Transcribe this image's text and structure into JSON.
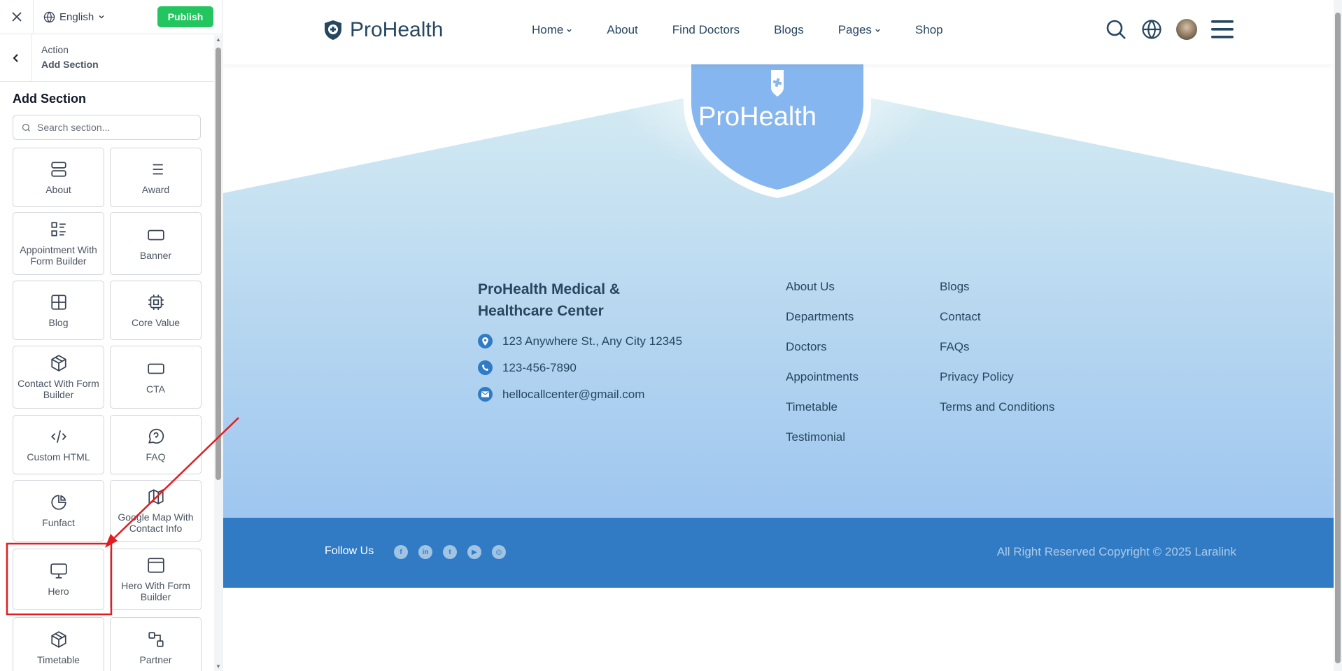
{
  "builder": {
    "language": "English",
    "publish_label": "Publish",
    "crumb_parent": "Action",
    "crumb_current": "Add Section",
    "section_title": "Add Section",
    "search_placeholder": "Search section...",
    "sections": [
      {
        "label": "About",
        "icon": "server-icon"
      },
      {
        "label": "Award",
        "icon": "list-icon"
      },
      {
        "label": "Appointment With Form Builder",
        "icon": "list-detail-icon"
      },
      {
        "label": "Banner",
        "icon": "rectangle-icon"
      },
      {
        "label": "Blog",
        "icon": "grid-icon"
      },
      {
        "label": "Core Value",
        "icon": "cpu-icon"
      },
      {
        "label": "Contact With Form Builder",
        "icon": "cube-icon"
      },
      {
        "label": "CTA",
        "icon": "input-dots-icon"
      },
      {
        "label": "Custom HTML",
        "icon": "code-icon"
      },
      {
        "label": "FAQ",
        "icon": "help-bubble-icon"
      },
      {
        "label": "Funfact",
        "icon": "pie-chart-icon"
      },
      {
        "label": "Google Map With Contact Info",
        "icon": "map-icon"
      },
      {
        "label": "Hero",
        "icon": "monitor-icon"
      },
      {
        "label": "Hero With Form Builder",
        "icon": "browser-window-icon"
      },
      {
        "label": "Timetable",
        "icon": "cube-icon"
      },
      {
        "label": "Partner",
        "icon": "shapes-icon"
      }
    ]
  },
  "site": {
    "brand": "ProHealth",
    "nav": [
      {
        "label": "Home",
        "dropdown": true
      },
      {
        "label": "About",
        "dropdown": false
      },
      {
        "label": "Find Doctors",
        "dropdown": false
      },
      {
        "label": "Blogs",
        "dropdown": false
      },
      {
        "label": "Pages",
        "dropdown": true
      },
      {
        "label": "Shop",
        "dropdown": false
      }
    ],
    "shield_brand": "ProHealth",
    "center_name": "ProHealth Medical & Healthcare Center",
    "address": "123 Anywhere St., Any City 12345",
    "phone": "123-456-7890",
    "email": "hellocallcenter@gmail.com",
    "links_col1": [
      "About Us",
      "Departments",
      "Doctors",
      "Appointments",
      "Timetable",
      "Testimonial"
    ],
    "links_col2": [
      "Blogs",
      "Contact",
      "FAQs",
      "Privacy Policy",
      "Terms and Conditions"
    ],
    "follow_label": "Follow Us",
    "socials": [
      "facebook-icon",
      "linkedin-icon",
      "twitter-icon",
      "youtube-icon",
      "instagram-icon"
    ],
    "copyright": "All Right Reserved Copyright © 2025 Laralink"
  },
  "colors": {
    "publish": "#22c55e",
    "brand_dark": "#274760",
    "brand_blue": "#307bc4",
    "shield": "#86b6ef",
    "annotation": "#e11d21"
  }
}
